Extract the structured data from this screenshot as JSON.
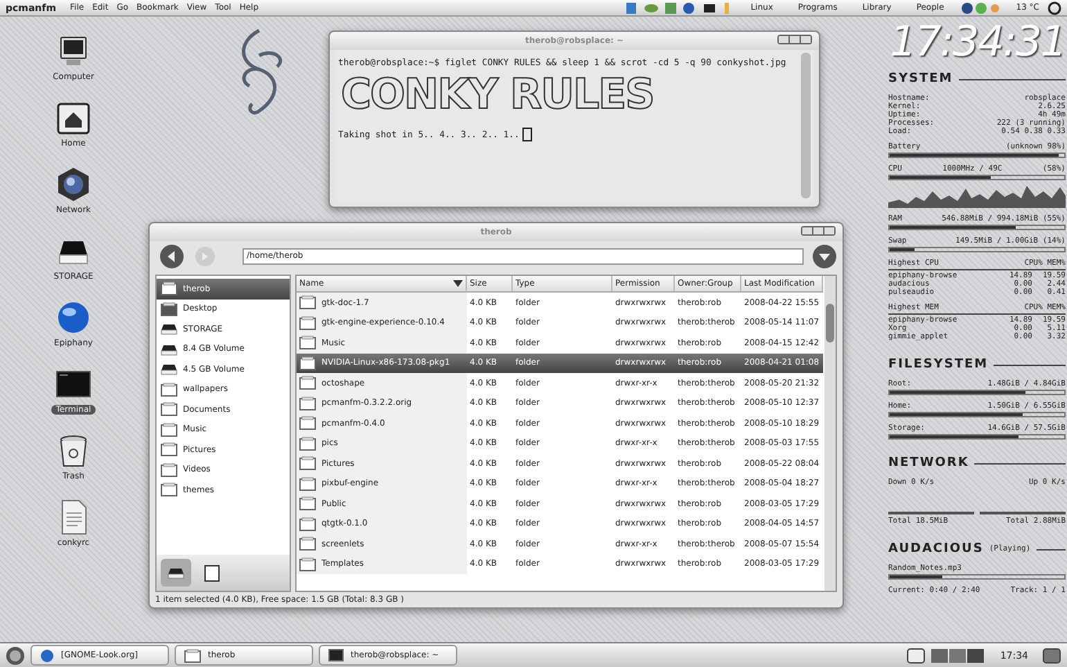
{
  "top_panel": {
    "app_name": "pcmanfm",
    "menus": [
      "File",
      "Edit",
      "Go",
      "Bookmark",
      "View",
      "Tool",
      "Help"
    ],
    "places": [
      "Linux",
      "Programs",
      "Library",
      "People"
    ],
    "temperature": "13 °C"
  },
  "desktop_icons": [
    {
      "label": "Computer",
      "kind": "computer",
      "selected": false
    },
    {
      "label": "Home",
      "kind": "home",
      "selected": false
    },
    {
      "label": "Network",
      "kind": "network",
      "selected": false
    },
    {
      "label": "STORAGE",
      "kind": "drive",
      "selected": false
    },
    {
      "label": "Epiphany",
      "kind": "browser",
      "selected": false
    },
    {
      "label": "Terminal",
      "kind": "terminal",
      "selected": true
    },
    {
      "label": "Trash",
      "kind": "trash",
      "selected": false
    },
    {
      "label": "conkyrc",
      "kind": "document",
      "selected": false
    }
  ],
  "terminal": {
    "title": "therob@robsplace: ~",
    "command": "therob@robsplace:~$ figlet CONKY RULES && sleep 1 && scrot -cd 5 -q 90 conkyshot.jpg",
    "banner": "CONKY RULES",
    "output": "Taking shot in 5.. 4.. 3.. 2.. 1.."
  },
  "file_manager": {
    "title": "therob",
    "path": "/home/therob",
    "sidebar": [
      {
        "label": "therob",
        "kind": "home",
        "selected": true
      },
      {
        "label": "Desktop",
        "kind": "desktop",
        "selected": false
      },
      {
        "label": "STORAGE",
        "kind": "drive",
        "selected": false
      },
      {
        "label": "8.4 GB Volume",
        "kind": "drive",
        "selected": false
      },
      {
        "label": "4.5 GB Volume",
        "kind": "drive",
        "selected": false
      },
      {
        "label": "wallpapers",
        "kind": "folder",
        "selected": false
      },
      {
        "label": "Documents",
        "kind": "folder",
        "selected": false
      },
      {
        "label": "Music",
        "kind": "folder",
        "selected": false
      },
      {
        "label": "Pictures",
        "kind": "folder",
        "selected": false
      },
      {
        "label": "Videos",
        "kind": "folder",
        "selected": false
      },
      {
        "label": "themes",
        "kind": "folder",
        "selected": false
      }
    ],
    "columns": [
      "Name",
      "Size",
      "Type",
      "Permission",
      "Owner:Group",
      "Last Modification"
    ],
    "rows": [
      {
        "cells": [
          "gtk-doc-1.7",
          "4.0 KB",
          "folder",
          "drwxrwxrwx",
          "therob:rob",
          "2008-04-22 15:55"
        ],
        "selected": false
      },
      {
        "cells": [
          "gtk-engine-experience-0.10.4",
          "4.0 KB",
          "folder",
          "drwxrwxrwx",
          "therob:therob",
          "2008-05-14 11:07"
        ],
        "selected": false
      },
      {
        "cells": [
          "Music",
          "4.0 KB",
          "folder",
          "drwxrwxrwx",
          "therob:rob",
          "2008-04-15 12:42"
        ],
        "selected": false
      },
      {
        "cells": [
          "NVIDIA-Linux-x86-173.08-pkg1",
          "4.0 KB",
          "folder",
          "drwxrwxrwx",
          "therob:rob",
          "2008-04-21 01:08"
        ],
        "selected": true
      },
      {
        "cells": [
          "octoshape",
          "4.0 KB",
          "folder",
          "drwxr-xr-x",
          "therob:therob",
          "2008-05-20 21:32"
        ],
        "selected": false
      },
      {
        "cells": [
          "pcmanfm-0.3.2.2.orig",
          "4.0 KB",
          "folder",
          "drwxrwxrwx",
          "therob:therob",
          "2008-05-10 12:37"
        ],
        "selected": false
      },
      {
        "cells": [
          "pcmanfm-0.4.0",
          "4.0 KB",
          "folder",
          "drwxrwxrwx",
          "therob:therob",
          "2008-05-10 18:29"
        ],
        "selected": false
      },
      {
        "cells": [
          "pics",
          "4.0 KB",
          "folder",
          "drwxr-xr-x",
          "therob:therob",
          "2008-05-03 17:55"
        ],
        "selected": false
      },
      {
        "cells": [
          "Pictures",
          "4.0 KB",
          "folder",
          "drwxrwxrwx",
          "therob:rob",
          "2008-05-22 08:04"
        ],
        "selected": false
      },
      {
        "cells": [
          "pixbuf-engine",
          "4.0 KB",
          "folder",
          "drwxr-xr-x",
          "therob:therob",
          "2008-05-04 18:27"
        ],
        "selected": false
      },
      {
        "cells": [
          "Public",
          "4.0 KB",
          "folder",
          "drwxrwxrwx",
          "therob:rob",
          "2008-03-05 17:29"
        ],
        "selected": false
      },
      {
        "cells": [
          "qtgtk-0.1.0",
          "4.0 KB",
          "folder",
          "drwxrwxrwx",
          "therob:rob",
          "2008-04-05 14:57"
        ],
        "selected": false
      },
      {
        "cells": [
          "screenlets",
          "4.0 KB",
          "folder",
          "drwxr-xr-x",
          "therob:therob",
          "2008-05-07 15:54"
        ],
        "selected": false
      },
      {
        "cells": [
          "Templates",
          "4.0 KB",
          "folder",
          "drwxrwxrwx",
          "therob:rob",
          "2008-03-05 17:29"
        ],
        "selected": false
      }
    ],
    "status": "1 item selected (4.0 KB), Free space: 1.5 GB (Total: 8.3 GB )"
  },
  "conky": {
    "clock": "17:34:31",
    "system": {
      "title": "SYSTEM",
      "info": [
        {
          "label": "Hostname:",
          "value": "robsplace"
        },
        {
          "label": "Kernel:",
          "value": "2.6.25"
        },
        {
          "label": "Uptime:",
          "value": "4h 49m"
        },
        {
          "label": "Processes:",
          "value": "222 (3 running)"
        },
        {
          "label": "Load:",
          "value": "0.54 0.38 0.33"
        }
      ]
    },
    "meters": [
      {
        "label": "Battery",
        "value": "(unknown 98%)",
        "level": 0.97
      },
      {
        "label": "CPU",
        "value": "1000MHz / 49C",
        "extra": "(58%)",
        "level": 0.58
      },
      {
        "label": "RAM",
        "value": "546.88MiB / 994.18MiB (55%)",
        "level": 0.72
      },
      {
        "label": "Swap",
        "value": "149.5MiB / 1.00GiB (14%)",
        "level": 0.14
      }
    ],
    "tops": [
      {
        "title": "Highest CPU",
        "header": "CPU% MEM%",
        "rows": [
          [
            "epiphany-browse",
            "14.89",
            "19.59"
          ],
          [
            "audacious",
            "0.00",
            "2.44"
          ],
          [
            "pulseaudio",
            "0.00",
            "0.41"
          ]
        ]
      },
      {
        "title": "Highest MEM",
        "header": "CPU% MEM%",
        "rows": [
          [
            "epiphany-browse",
            "14.89",
            "19.59"
          ],
          [
            "Xorg",
            "0.00",
            "5.11"
          ],
          [
            "gimmie_applet",
            "0.00",
            "3.32"
          ]
        ]
      }
    ],
    "filesystem": {
      "title": "FILESYSTEM",
      "items": [
        {
          "label": "Root:",
          "value": "1.48GiB / 4.84GiB",
          "level": 0.78
        },
        {
          "label": "Home:",
          "value": "1.50GiB / 6.55GiB",
          "level": 0.76
        },
        {
          "label": "Storage:",
          "value": "14.6GiB / 57.5GiB",
          "level": 0.74
        }
      ]
    },
    "network": {
      "title": "NETWORK",
      "down": "Down 0 K/s",
      "up": "Up 0 K/s",
      "total_down": "Total 18.5MiB",
      "total_up": "Total 2.88MiB"
    },
    "audacious": {
      "title": "AUDACIOUS",
      "status": "(Playing)",
      "track": "Random_Notes.mp3",
      "level": 0.3,
      "current": "Current: 0:40 / 2:40",
      "track_no": "Track: 1 / 1"
    }
  },
  "taskbar": {
    "tasks": [
      {
        "label": "[GNOME-Look.org]",
        "kind": "browser"
      },
      {
        "label": "therob",
        "kind": "folder"
      },
      {
        "label": "therob@robsplace: ~",
        "kind": "terminal"
      }
    ],
    "clock": "17:34"
  }
}
